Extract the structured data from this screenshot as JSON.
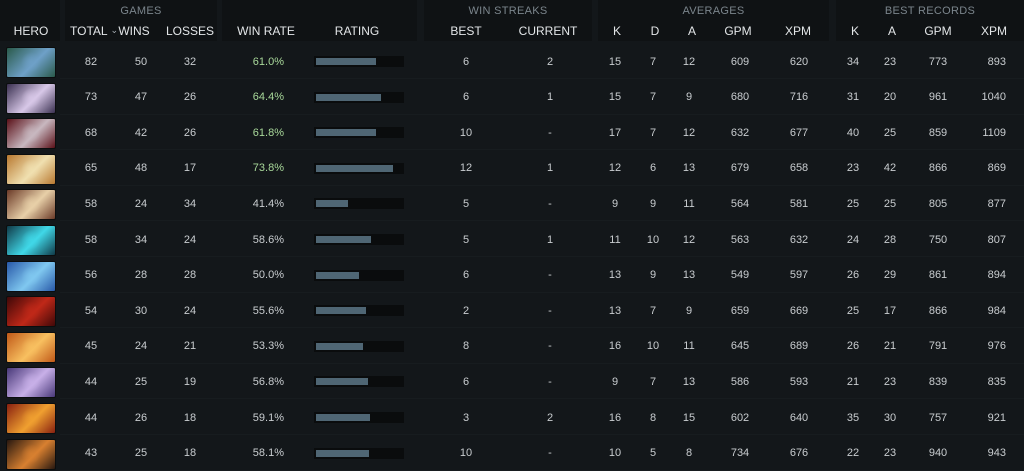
{
  "group_headers": {
    "games": "GAMES",
    "win_streaks": "WIN STREAKS",
    "averages": "AVERAGES",
    "best_records": "BEST RECORDS"
  },
  "columns": {
    "hero": "HERO",
    "total": "TOTAL",
    "sort_indicator": "⌄",
    "wins": "WINS",
    "losses": "LOSSES",
    "win_rate": "WIN RATE",
    "rating": "RATING",
    "best": "BEST",
    "current": "CURRENT",
    "avg_k": "K",
    "avg_d": "D",
    "avg_a": "A",
    "avg_gpm": "GPM",
    "avg_xpm": "XPM",
    "best_k": "K",
    "best_a": "A",
    "best_gpm": "GPM",
    "best_xpm": "XPM"
  },
  "rows": [
    {
      "total": "82",
      "wins": "50",
      "losses": "32",
      "win_rate": "61.0%",
      "rating": 0.7,
      "best": "6",
      "current": "2",
      "k": "15",
      "d": "7",
      "a": "12",
      "gpm": "609",
      "xpm": "620",
      "bk": "34",
      "ba": "23",
      "bgpm": "773",
      "bxpm": "893",
      "portrait_colors": [
        "#2a5a4a",
        "#6ea0c8"
      ],
      "highlight": true
    },
    {
      "total": "73",
      "wins": "47",
      "losses": "26",
      "win_rate": "64.4%",
      "rating": 0.75,
      "best": "6",
      "current": "1",
      "k": "15",
      "d": "7",
      "a": "9",
      "gpm": "680",
      "xpm": "716",
      "bk": "31",
      "ba": "20",
      "bgpm": "961",
      "bxpm": "1040",
      "portrait_colors": [
        "#3a3050",
        "#d8c8e8"
      ],
      "highlight": true
    },
    {
      "total": "68",
      "wins": "42",
      "losses": "26",
      "win_rate": "61.8%",
      "rating": 0.7,
      "best": "10",
      "current": "-",
      "k": "17",
      "d": "7",
      "a": "12",
      "gpm": "632",
      "xpm": "677",
      "bk": "40",
      "ba": "25",
      "bgpm": "859",
      "bxpm": "1109",
      "portrait_colors": [
        "#5a1018",
        "#c8b8c0"
      ],
      "highlight": true
    },
    {
      "total": "65",
      "wins": "48",
      "losses": "17",
      "win_rate": "73.8%",
      "rating": 0.9,
      "best": "12",
      "current": "1",
      "k": "12",
      "d": "6",
      "a": "13",
      "gpm": "679",
      "xpm": "658",
      "bk": "23",
      "ba": "42",
      "bgpm": "866",
      "bxpm": "869",
      "portrait_colors": [
        "#b87830",
        "#f0e0b0"
      ],
      "highlight": true
    },
    {
      "total": "58",
      "wins": "24",
      "losses": "34",
      "win_rate": "41.4%",
      "rating": 0.37,
      "best": "5",
      "current": "-",
      "k": "9",
      "d": "9",
      "a": "11",
      "gpm": "564",
      "xpm": "581",
      "bk": "25",
      "ba": "25",
      "bgpm": "805",
      "bxpm": "877",
      "portrait_colors": [
        "#6a3a28",
        "#e8d0a8"
      ],
      "highlight": false
    },
    {
      "total": "58",
      "wins": "34",
      "losses": "24",
      "win_rate": "58.6%",
      "rating": 0.64,
      "best": "5",
      "current": "1",
      "k": "11",
      "d": "10",
      "a": "12",
      "gpm": "563",
      "xpm": "632",
      "bk": "24",
      "ba": "28",
      "bgpm": "750",
      "bxpm": "807",
      "portrait_colors": [
        "#103a48",
        "#40d8e8"
      ],
      "highlight": false
    },
    {
      "total": "56",
      "wins": "28",
      "losses": "28",
      "win_rate": "50.0%",
      "rating": 0.5,
      "best": "6",
      "current": "-",
      "k": "13",
      "d": "9",
      "a": "13",
      "gpm": "549",
      "xpm": "597",
      "bk": "26",
      "ba": "29",
      "bgpm": "861",
      "bxpm": "894",
      "portrait_colors": [
        "#2858a8",
        "#80c8f0"
      ],
      "highlight": false
    },
    {
      "total": "54",
      "wins": "30",
      "losses": "24",
      "win_rate": "55.6%",
      "rating": 0.58,
      "best": "2",
      "current": "-",
      "k": "13",
      "d": "7",
      "a": "9",
      "gpm": "659",
      "xpm": "669",
      "bk": "25",
      "ba": "17",
      "bgpm": "866",
      "bxpm": "984",
      "portrait_colors": [
        "#400808",
        "#c02818"
      ],
      "highlight": false
    },
    {
      "total": "45",
      "wins": "24",
      "losses": "21",
      "win_rate": "53.3%",
      "rating": 0.55,
      "best": "8",
      "current": "-",
      "k": "16",
      "d": "10",
      "a": "11",
      "gpm": "645",
      "xpm": "689",
      "bk": "26",
      "ba": "21",
      "bgpm": "791",
      "bxpm": "976",
      "portrait_colors": [
        "#c05818",
        "#f8c060"
      ],
      "highlight": false
    },
    {
      "total": "44",
      "wins": "25",
      "losses": "19",
      "win_rate": "56.8%",
      "rating": 0.6,
      "best": "6",
      "current": "-",
      "k": "9",
      "d": "7",
      "a": "13",
      "gpm": "586",
      "xpm": "593",
      "bk": "21",
      "ba": "23",
      "bgpm": "839",
      "bxpm": "835",
      "portrait_colors": [
        "#483878",
        "#c8b0e8"
      ],
      "highlight": false
    },
    {
      "total": "44",
      "wins": "26",
      "losses": "18",
      "win_rate": "59.1%",
      "rating": 0.63,
      "best": "3",
      "current": "2",
      "k": "16",
      "d": "8",
      "a": "15",
      "gpm": "602",
      "xpm": "640",
      "bk": "35",
      "ba": "30",
      "bgpm": "757",
      "bxpm": "921",
      "portrait_colors": [
        "#882010",
        "#f0a030"
      ],
      "highlight": false
    },
    {
      "total": "43",
      "wins": "25",
      "losses": "18",
      "win_rate": "58.1%",
      "rating": 0.62,
      "best": "10",
      "current": "-",
      "k": "10",
      "d": "5",
      "a": "8",
      "gpm": "734",
      "xpm": "676",
      "bk": "22",
      "ba": "23",
      "bgpm": "940",
      "bxpm": "943",
      "portrait_colors": [
        "#281810",
        "#d88030"
      ],
      "highlight": false
    }
  ]
}
